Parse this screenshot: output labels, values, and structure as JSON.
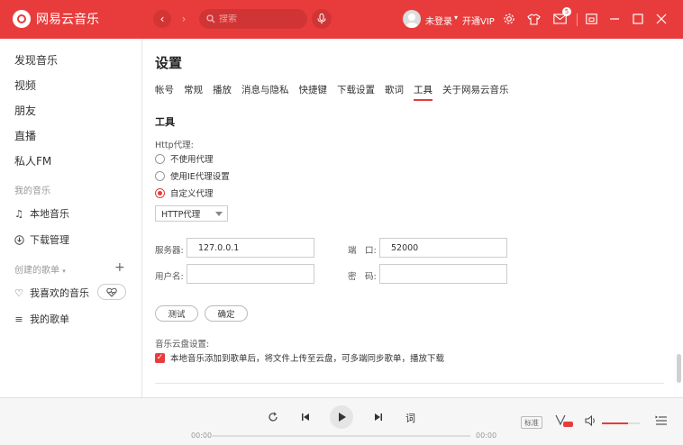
{
  "app": {
    "name": "网易云音乐",
    "search_placeholder": "搜索",
    "login_text": "未登录",
    "vip_text": "开通VIP",
    "mail_badge": "5"
  },
  "colors": {
    "brand_red": "#e83c3c"
  },
  "icons": [
    "logo-icon",
    "back-icon",
    "forward-icon",
    "search-icon",
    "mic-icon",
    "gear-icon",
    "shirt-icon",
    "mail-icon",
    "mini-mode-icon",
    "minimize-icon",
    "maximize-icon",
    "close-icon",
    "music-note-icon",
    "download-icon",
    "heart-icon",
    "heartbeat-icon",
    "playlist-icon",
    "loop-icon",
    "previous-icon",
    "play-icon",
    "next-icon",
    "lyrics-icon",
    "sound-effect-icon",
    "volume-icon",
    "queue-icon"
  ],
  "sidebar": {
    "items": [
      "发现音乐",
      "视频",
      "朋友",
      "直播",
      "私人FM"
    ],
    "my_music_label": "我的音乐",
    "my_music_items": [
      "本地音乐",
      "下载管理"
    ],
    "created_playlists_label": "创建的歌单",
    "playlists": [
      "我喜欢的音乐",
      "我的歌单"
    ]
  },
  "settings": {
    "title": "设置",
    "tabs": [
      "帐号",
      "常规",
      "播放",
      "消息与隐私",
      "快捷键",
      "下载设置",
      "歌词",
      "工具",
      "关于网易云音乐"
    ],
    "active_tab": "工具",
    "section_title": "工具",
    "http_proxy_label": "Http代理:",
    "proxy_options": [
      "不使用代理",
      "使用IE代理设置",
      "自定义代理"
    ],
    "selected_proxy": "自定义代理",
    "proxy_type": "HTTP代理",
    "server_label": "服务器:",
    "server_value": "127.0.0.1",
    "port_label": "端　口:",
    "port_value": "52000",
    "username_label": "用户名:",
    "username_value": "",
    "password_label": "密　码:",
    "password_value": "",
    "test_button": "测试",
    "confirm_button": "确定",
    "cloud_label": "音乐云盘设置:",
    "cloud_checkbox": "本地音乐添加到歌单后，将文件上传至云盘，可多端同步歌单，播放下载",
    "cloud_checked": true
  },
  "player": {
    "current_time": "00:00",
    "total_time": "00:00",
    "progress": 0,
    "quality": "标准",
    "lyrics_label": "词",
    "volume": 0.7
  }
}
